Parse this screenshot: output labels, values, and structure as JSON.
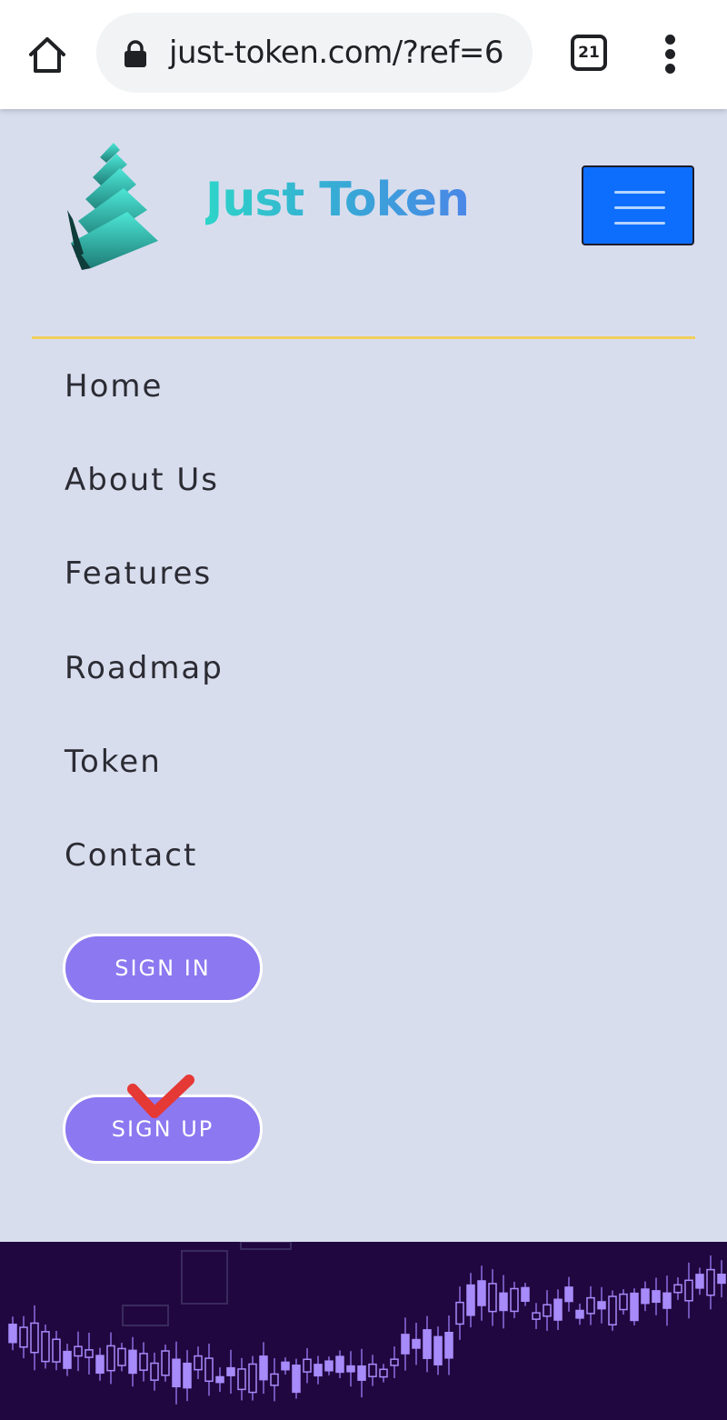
{
  "browser": {
    "url": "just-token.com/?ref=6",
    "tab_count": "21"
  },
  "header": {
    "brand": "Just Token"
  },
  "nav": {
    "items": [
      {
        "label": "Home"
      },
      {
        "label": "About Us"
      },
      {
        "label": "Features"
      },
      {
        "label": "Roadmap"
      },
      {
        "label": "Token"
      },
      {
        "label": "Contact"
      }
    ]
  },
  "buttons": {
    "sign_in": "SIGN IN",
    "sign_up": "SIGN UP"
  },
  "colors": {
    "page_bg": "#d8ddee",
    "accent_blue": "#0d6efd",
    "button_purple": "#8c78f0",
    "divider_gold": "#f2cf5b",
    "footer_bg": "#21073f",
    "checkmark_red": "#e53935"
  },
  "icons": [
    "home-icon",
    "lock-icon",
    "tabs-icon",
    "more-vert-icon",
    "hamburger-icon",
    "checkmark-icon"
  ]
}
